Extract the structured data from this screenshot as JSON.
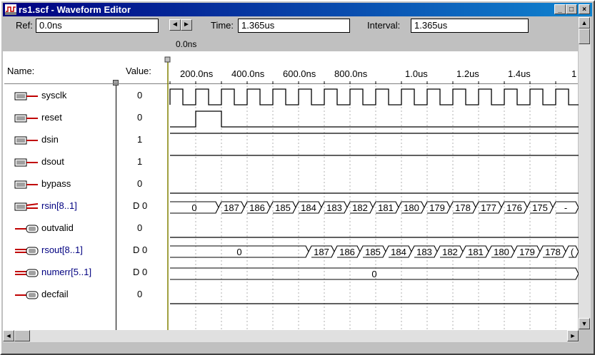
{
  "window": {
    "title": "rs1.scf - Waveform Editor",
    "minimize": "_",
    "maximize": "□",
    "close": "×"
  },
  "toolbar": {
    "ref_label": "Ref:",
    "ref_value": "0.0ns",
    "time_label": "Time:",
    "time_value": "1.365us",
    "interval_label": "Interval:",
    "interval_value": "1.365us",
    "cursor_time": "0.0ns"
  },
  "header": {
    "name_label": "Name:",
    "value_label": "Value:"
  },
  "time_axis": [
    "200.0ns",
    "400.0ns",
    "600.0ns",
    "800.0ns",
    "1.0us",
    "1.2us",
    "1.4us",
    "1"
  ],
  "signals": [
    {
      "name": "sysclk",
      "value": "0",
      "kind": "input",
      "group": false
    },
    {
      "name": "reset",
      "value": "0",
      "kind": "input",
      "group": false
    },
    {
      "name": "dsin",
      "value": "1",
      "kind": "input",
      "group": false
    },
    {
      "name": "dsout",
      "value": "1",
      "kind": "input",
      "group": false
    },
    {
      "name": "bypass",
      "value": "0",
      "kind": "input",
      "group": false
    },
    {
      "name": "rsin[8..1]",
      "value": "D 0",
      "kind": "input",
      "group": true
    },
    {
      "name": "outvalid",
      "value": "0",
      "kind": "output",
      "group": false
    },
    {
      "name": "rsout[8..1]",
      "value": "D 0",
      "kind": "output",
      "group": true
    },
    {
      "name": "numerr[5..1]",
      "value": "D 0",
      "kind": "output",
      "group": true
    },
    {
      "name": "decfail",
      "value": "0",
      "kind": "output",
      "group": false
    }
  ],
  "waves": {
    "rsin": [
      "0",
      "187",
      "186",
      "185",
      "184",
      "183",
      "182",
      "181",
      "180",
      "179",
      "178",
      "177",
      "176",
      "175",
      "-"
    ],
    "rsout": [
      "0",
      "187",
      "186",
      "185",
      "184",
      "183",
      "182",
      "181",
      "180",
      "179",
      "178",
      "("
    ],
    "numerr": [
      "0"
    ]
  },
  "scroll": {
    "up": "▲",
    "down": "▼",
    "left": "◄",
    "right": "►",
    "nav_left": "◄",
    "nav_right": "►"
  }
}
